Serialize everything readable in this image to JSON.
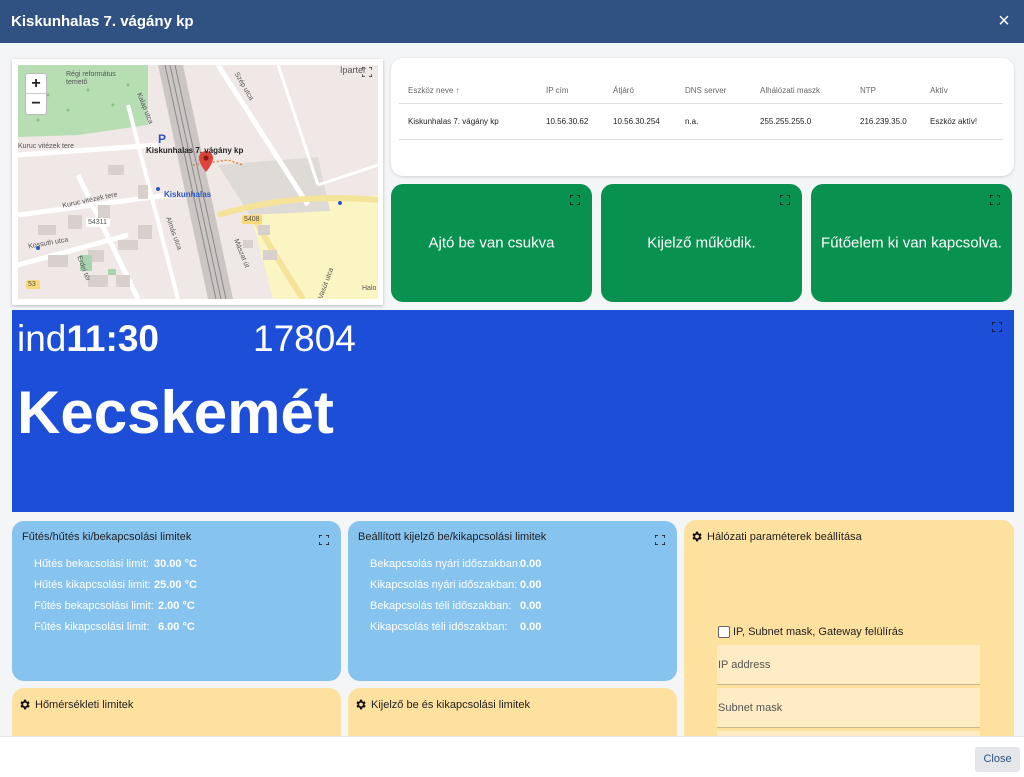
{
  "window": {
    "title": "Kiskunhalas 7. vágány kp",
    "close_icon": "×"
  },
  "map": {
    "zoom_in": "+",
    "zoom_out": "−",
    "labels": {
      "reformatus": "Régi református\ntemető",
      "iparter": "Iparter",
      "station_title": "Kiskunhalas 7. vágány kp",
      "station": "Kiskunhalas",
      "kuruc_tere": "Kuruc vitézek tere",
      "kuruc_tere2": "Kuruc vitézek tere",
      "kossuth": "Kossuth utca",
      "route_54311": "54311",
      "route_5408": "5408",
      "route_53": "53",
      "almas": "Almás utca",
      "masz": "Mászat út",
      "halo": "Halo",
      "kalap": "Kalap utca",
      "erdei": "Erdei tér",
      "szep": "Szép utca",
      "vasut": "Vasút utca"
    }
  },
  "device_table": {
    "headers": [
      "Eszköz neve ↑",
      "IP cím",
      "Átjáró",
      "DNS server",
      "Alhálózati maszk",
      "NTP",
      "Aktív"
    ],
    "rows": [
      [
        "Kiskunhalas 7. vágány kp",
        "10.56.30.62",
        "10.56.30.254",
        "n.a.",
        "255.255.255.0",
        "216.239.35.0",
        "Eszköz aktív!"
      ]
    ]
  },
  "status_tiles": [
    {
      "text": "Ajtó be van csukva"
    },
    {
      "text": "Kijelző működik."
    },
    {
      "text": "Fűtőelem ki van kapcsolva."
    }
  ],
  "display": {
    "prefix": "ind",
    "time": "11:30",
    "train_number": "17804",
    "destination": "Kecskemét"
  },
  "heating_limits": {
    "title": "Fűtés/hűtés ki/bekapcsolási limitek",
    "rows": [
      {
        "label": "Hűtés bekacsolási limit:",
        "value": "30.00 °C"
      },
      {
        "label": "Hűtés kikapcsolási limit:",
        "value": "25.00 °C"
      },
      {
        "label": "Fűtés bekapcsolási limit:",
        "value": "2.00 °C"
      },
      {
        "label": "Fűtés kikapcsolási limit:",
        "value": "6.00 °C"
      }
    ]
  },
  "display_limits": {
    "title": "Beállított kijelző be/kikapcsolási limitek",
    "rows": [
      {
        "label": "Bekapcsolás nyári időszakban:",
        "value": "0.00"
      },
      {
        "label": "Kikapcsolás nyári időszakban:",
        "value": "0.00"
      },
      {
        "label": "Bekapcsolás téli időszakban:",
        "value": "0.00"
      },
      {
        "label": "Kikapcsolás téli időszakban:",
        "value": "0.00"
      }
    ]
  },
  "network_settings": {
    "title": "Hálózati paraméterek beállítása",
    "override_label": "IP, Subnet mask, Gateway felülírás",
    "ip_placeholder": "IP address",
    "subnet_placeholder": "Subnet mask"
  },
  "temp_limits": {
    "title": "Hőmérsékleti limitek"
  },
  "display_onoff_limits": {
    "title": "Kijelző be és kikapcsolási limitek"
  },
  "footer": {
    "close_label": "Close"
  },
  "colors": {
    "header": "#2f5282",
    "tile_green": "#08914f",
    "banner_blue": "#1d4ed8",
    "card_blue": "#87c3ef",
    "card_yellow": "#fee09f"
  }
}
